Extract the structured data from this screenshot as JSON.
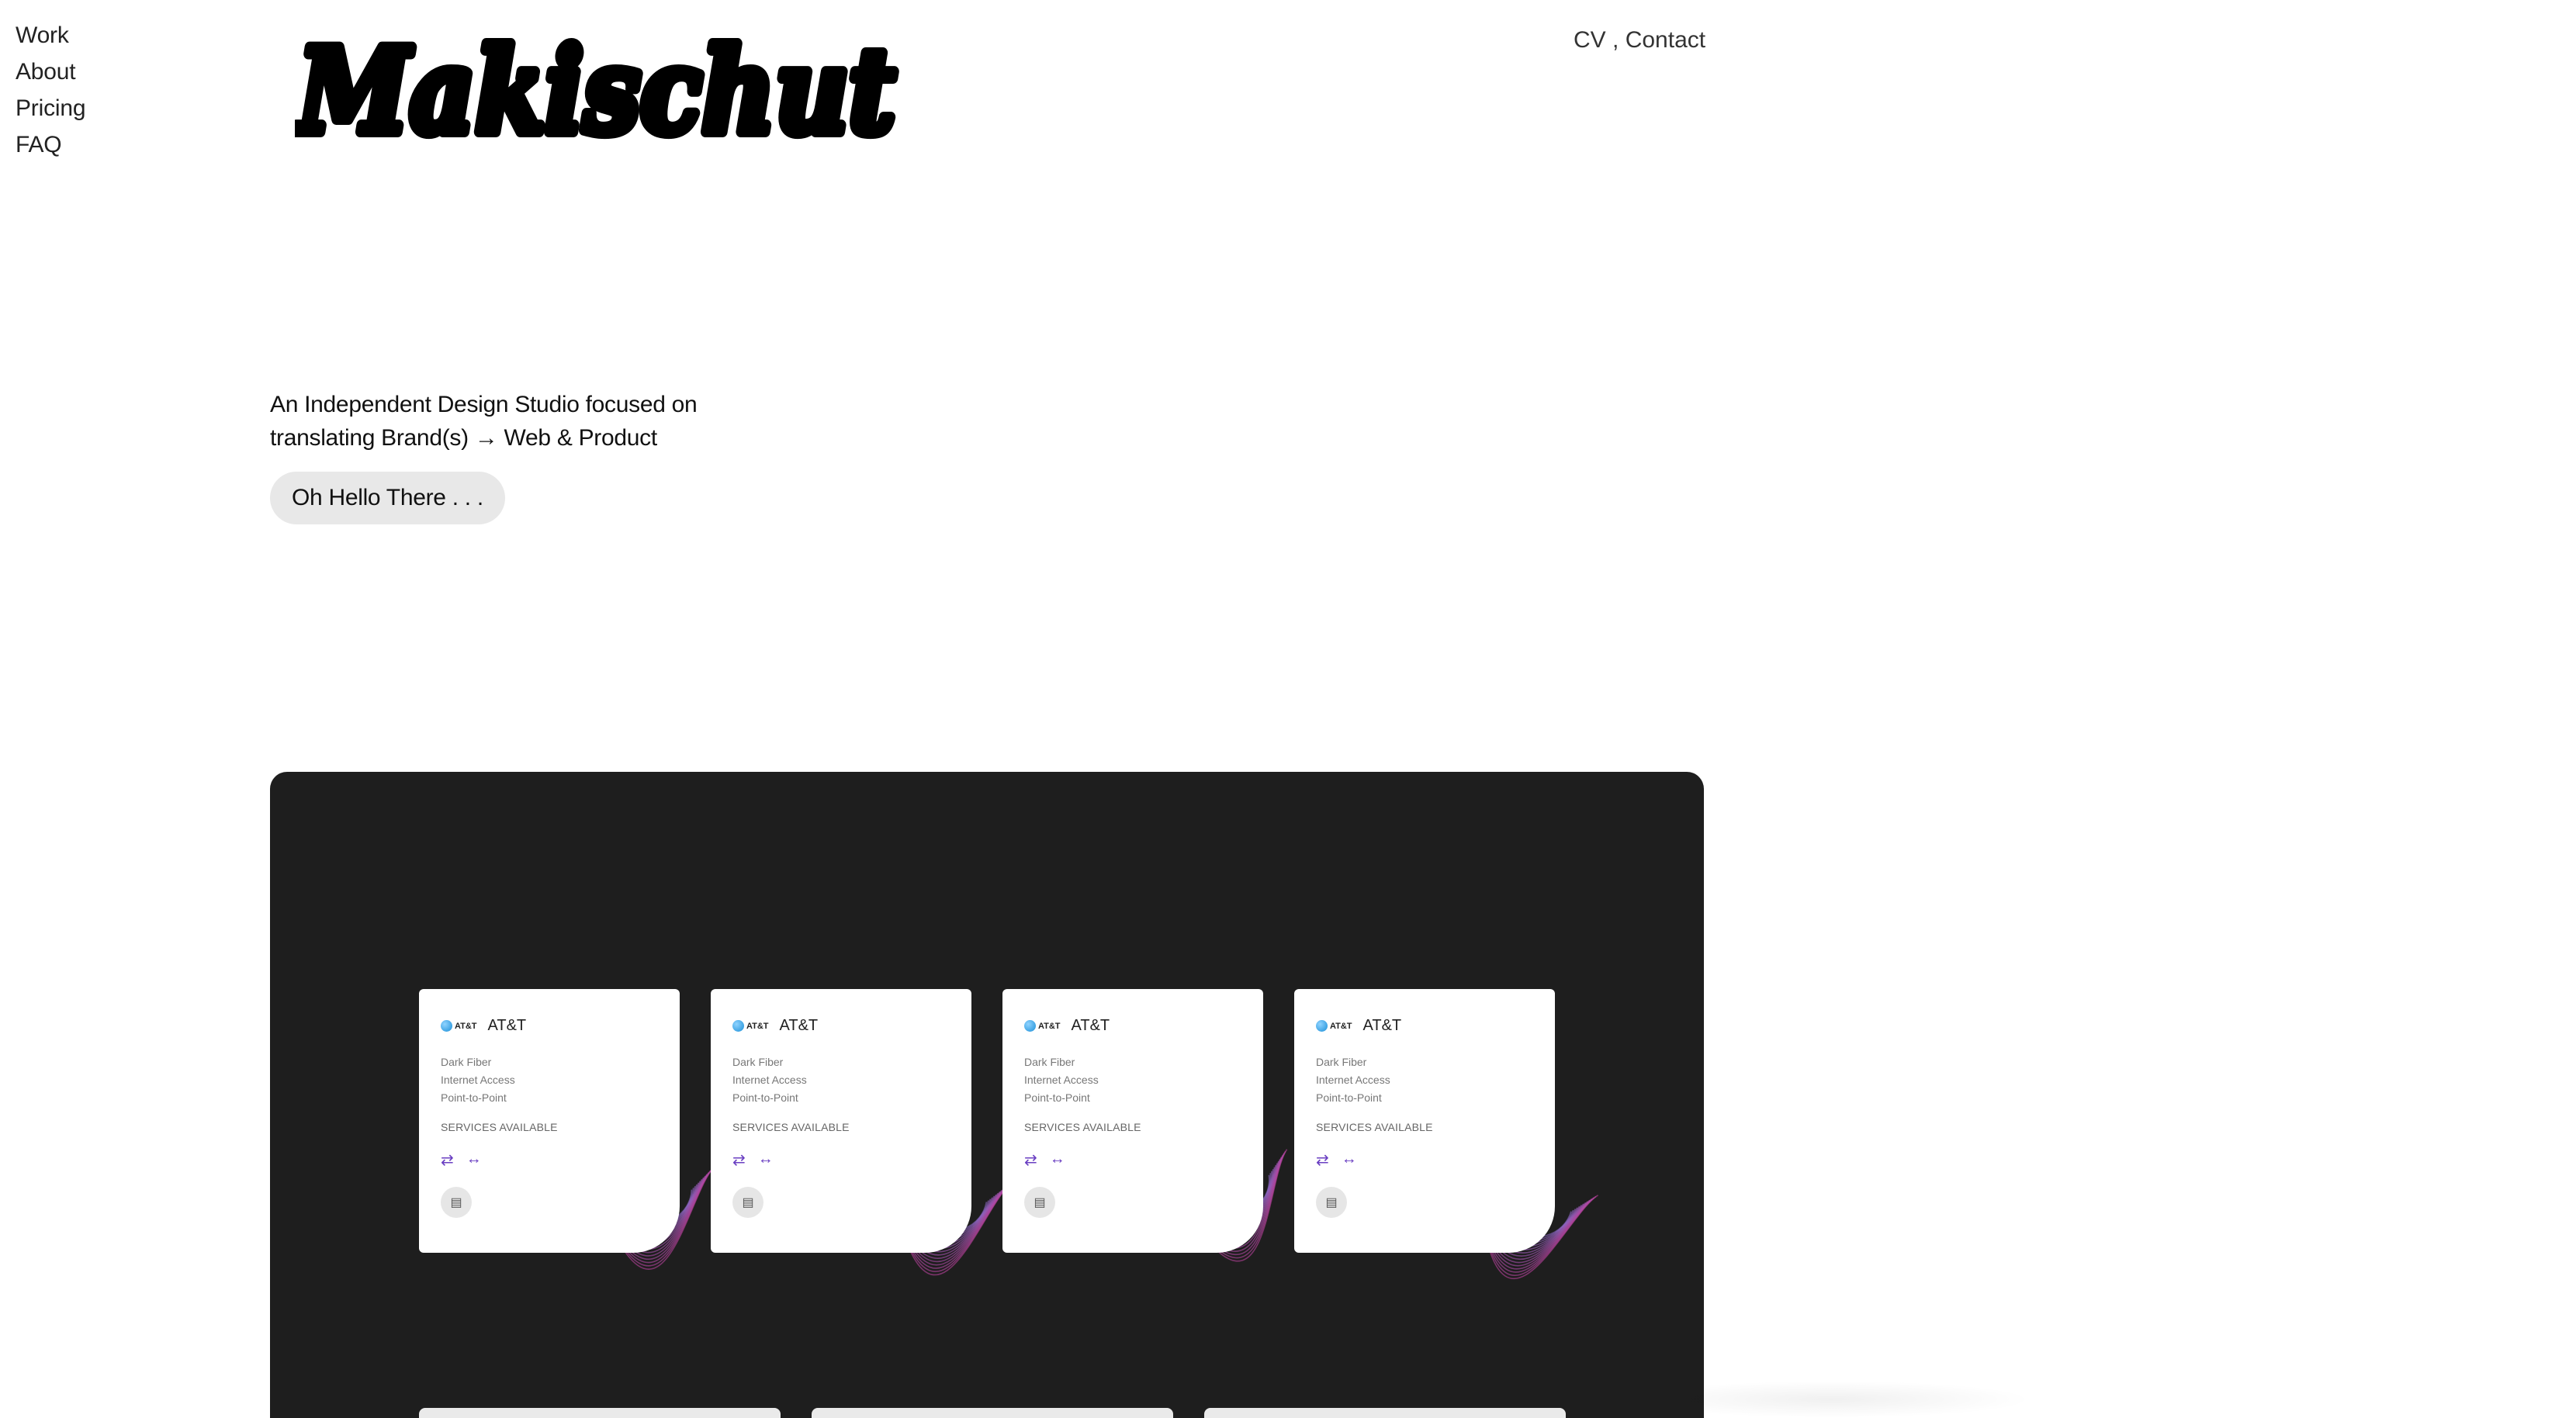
{
  "nav": {
    "items": [
      "Work",
      "About",
      "Pricing",
      "FAQ"
    ]
  },
  "logo": {
    "text": "Makischut"
  },
  "topright": {
    "cv": "CV",
    "separator": " , ",
    "contact": "Contact"
  },
  "hero": {
    "line1": "An Independent Design Studio focused on",
    "line2": "translating Brand(s) → Web & Product",
    "button": "Oh Hello There . . ."
  },
  "showcase": {
    "background": "#1e1e1e",
    "cards": [
      {
        "mini": "AT&T",
        "brand": "AT&T",
        "services": [
          "Dark Fiber",
          "Internet Access",
          "Point-to-Point"
        ],
        "title": "SERVICES AVAILABLE"
      },
      {
        "mini": "AT&T",
        "brand": "AT&T",
        "services": [
          "Dark Fiber",
          "Internet Access",
          "Point-to-Point"
        ],
        "title": "SERVICES AVAILABLE"
      },
      {
        "mini": "AT&T",
        "brand": "AT&T",
        "services": [
          "Dark Fiber",
          "Internet Access",
          "Point-to-Point"
        ],
        "title": "SERVICES AVAILABLE"
      },
      {
        "mini": "AT&T",
        "brand": "AT&T",
        "services": [
          "Dark Fiber",
          "Internet Access",
          "Point-to-Point"
        ],
        "title": "SERVICES AVAILABLE"
      }
    ],
    "icons": [
      "swap-arrows-icon",
      "double-arrow-icon",
      "store-icon",
      "globe-icon"
    ]
  }
}
